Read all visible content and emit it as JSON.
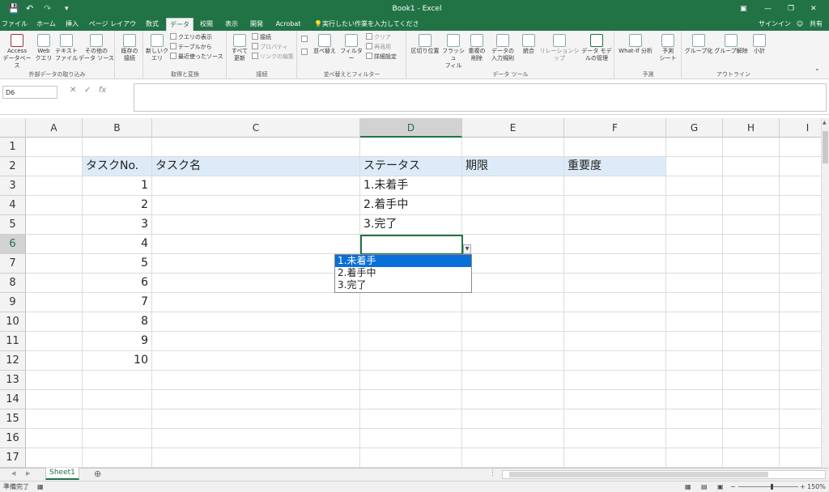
{
  "title": "Book1 - Excel",
  "tell_me": "実行したい作業を入力してください...",
  "signin": "サインイン",
  "share": "共有",
  "tabs": [
    "ファイル",
    "ホーム",
    "挿入",
    "ページ レイアウト",
    "数式",
    "データ",
    "校閲",
    "表示",
    "開発",
    "Acrobat"
  ],
  "ribbon": {
    "access": "Access\nデータベース",
    "web": "Web\nクエリ",
    "text_file": "テキスト\nファイル",
    "other_sources": "その他の\nデータ ソース",
    "existing": "既存の\n接続",
    "new_query": "新しいク\nエリ",
    "show_queries": "クエリの表示",
    "from_table": "テーブルから",
    "recent_sources": "最近使ったソース",
    "refresh_all": "すべて\n更新",
    "connections": "接続",
    "properties": "プロパティ",
    "edit_links": "リンクの編集",
    "sort": "並べ替え",
    "filter": "フィルター",
    "clear": "クリア",
    "reapply": "再適用",
    "advanced": "詳細設定",
    "text_to_columns": "区切り位置",
    "flash_fill": "フラッシュ\nフィル",
    "remove_dup": "重複の\n削除",
    "data_validation": "データの\n入力規則",
    "consolidate": "統合",
    "relationships": "リレーションシップ",
    "data_model": "データ モデ\nルの管理",
    "whatif": "What-If 分析",
    "forecast": "予測\nシート",
    "group": "グループ化",
    "ungroup": "グループ解除",
    "subtotal": "小計",
    "groups": [
      "外部データの取り込み",
      "取得と変換",
      "接続",
      "並べ替えとフィルター",
      "データ ツール",
      "予測",
      "アウトライン"
    ]
  },
  "namebox": "D6",
  "fx": "fx",
  "columns": [
    "A",
    "B",
    "C",
    "D",
    "E",
    "F",
    "G",
    "H",
    "I"
  ],
  "rows": [
    "1",
    "2",
    "3",
    "4",
    "5",
    "6",
    "7",
    "8",
    "9",
    "10",
    "11",
    "12",
    "13",
    "14",
    "15",
    "16",
    "17"
  ],
  "headers": {
    "b": "タスクNo.",
    "c": "タスク名",
    "d": "ステータス",
    "e": "期限",
    "f": "重要度"
  },
  "task_numbers": [
    "1",
    "2",
    "3",
    "4",
    "5",
    "6",
    "7",
    "8",
    "9",
    "10"
  ],
  "status_values": [
    "1.未着手",
    "2.着手中",
    "3.完了"
  ],
  "dropdown_options": [
    "1.未着手",
    "2.着手中",
    "3.完了"
  ],
  "sheet_tab": "Sheet1",
  "status_text": "準備完了",
  "zoom": "150%"
}
